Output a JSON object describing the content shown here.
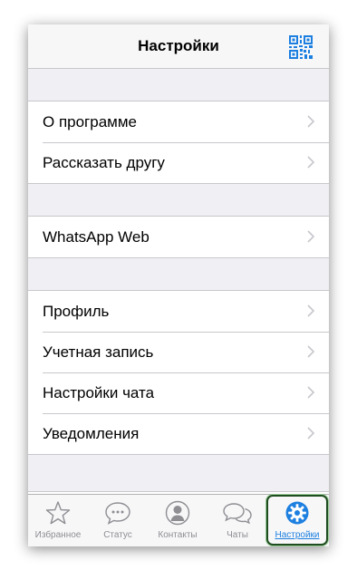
{
  "navbar": {
    "title": "Настройки",
    "qr_icon": "qr-code-icon"
  },
  "groups": [
    {
      "rows": [
        {
          "label": "О программе"
        },
        {
          "label": "Рассказать другу"
        }
      ]
    },
    {
      "rows": [
        {
          "label": "WhatsApp Web"
        }
      ]
    },
    {
      "rows": [
        {
          "label": "Профиль"
        },
        {
          "label": "Учетная запись"
        },
        {
          "label": "Настройки чата"
        },
        {
          "label": "Уведомления"
        }
      ]
    }
  ],
  "tabbar": {
    "tabs": [
      {
        "label": "Избранное",
        "icon": "star-icon"
      },
      {
        "label": "Статус",
        "icon": "speech-bubble-icon"
      },
      {
        "label": "Контакты",
        "icon": "contact-icon"
      },
      {
        "label": "Чаты",
        "icon": "chats-icon"
      },
      {
        "label": "Настройки",
        "icon": "gear-icon",
        "active": true
      }
    ]
  },
  "colors": {
    "accent": "#1d7fe0",
    "inactive": "#8e8e93",
    "background": "#efeff4",
    "separator": "#c8c7cc"
  }
}
